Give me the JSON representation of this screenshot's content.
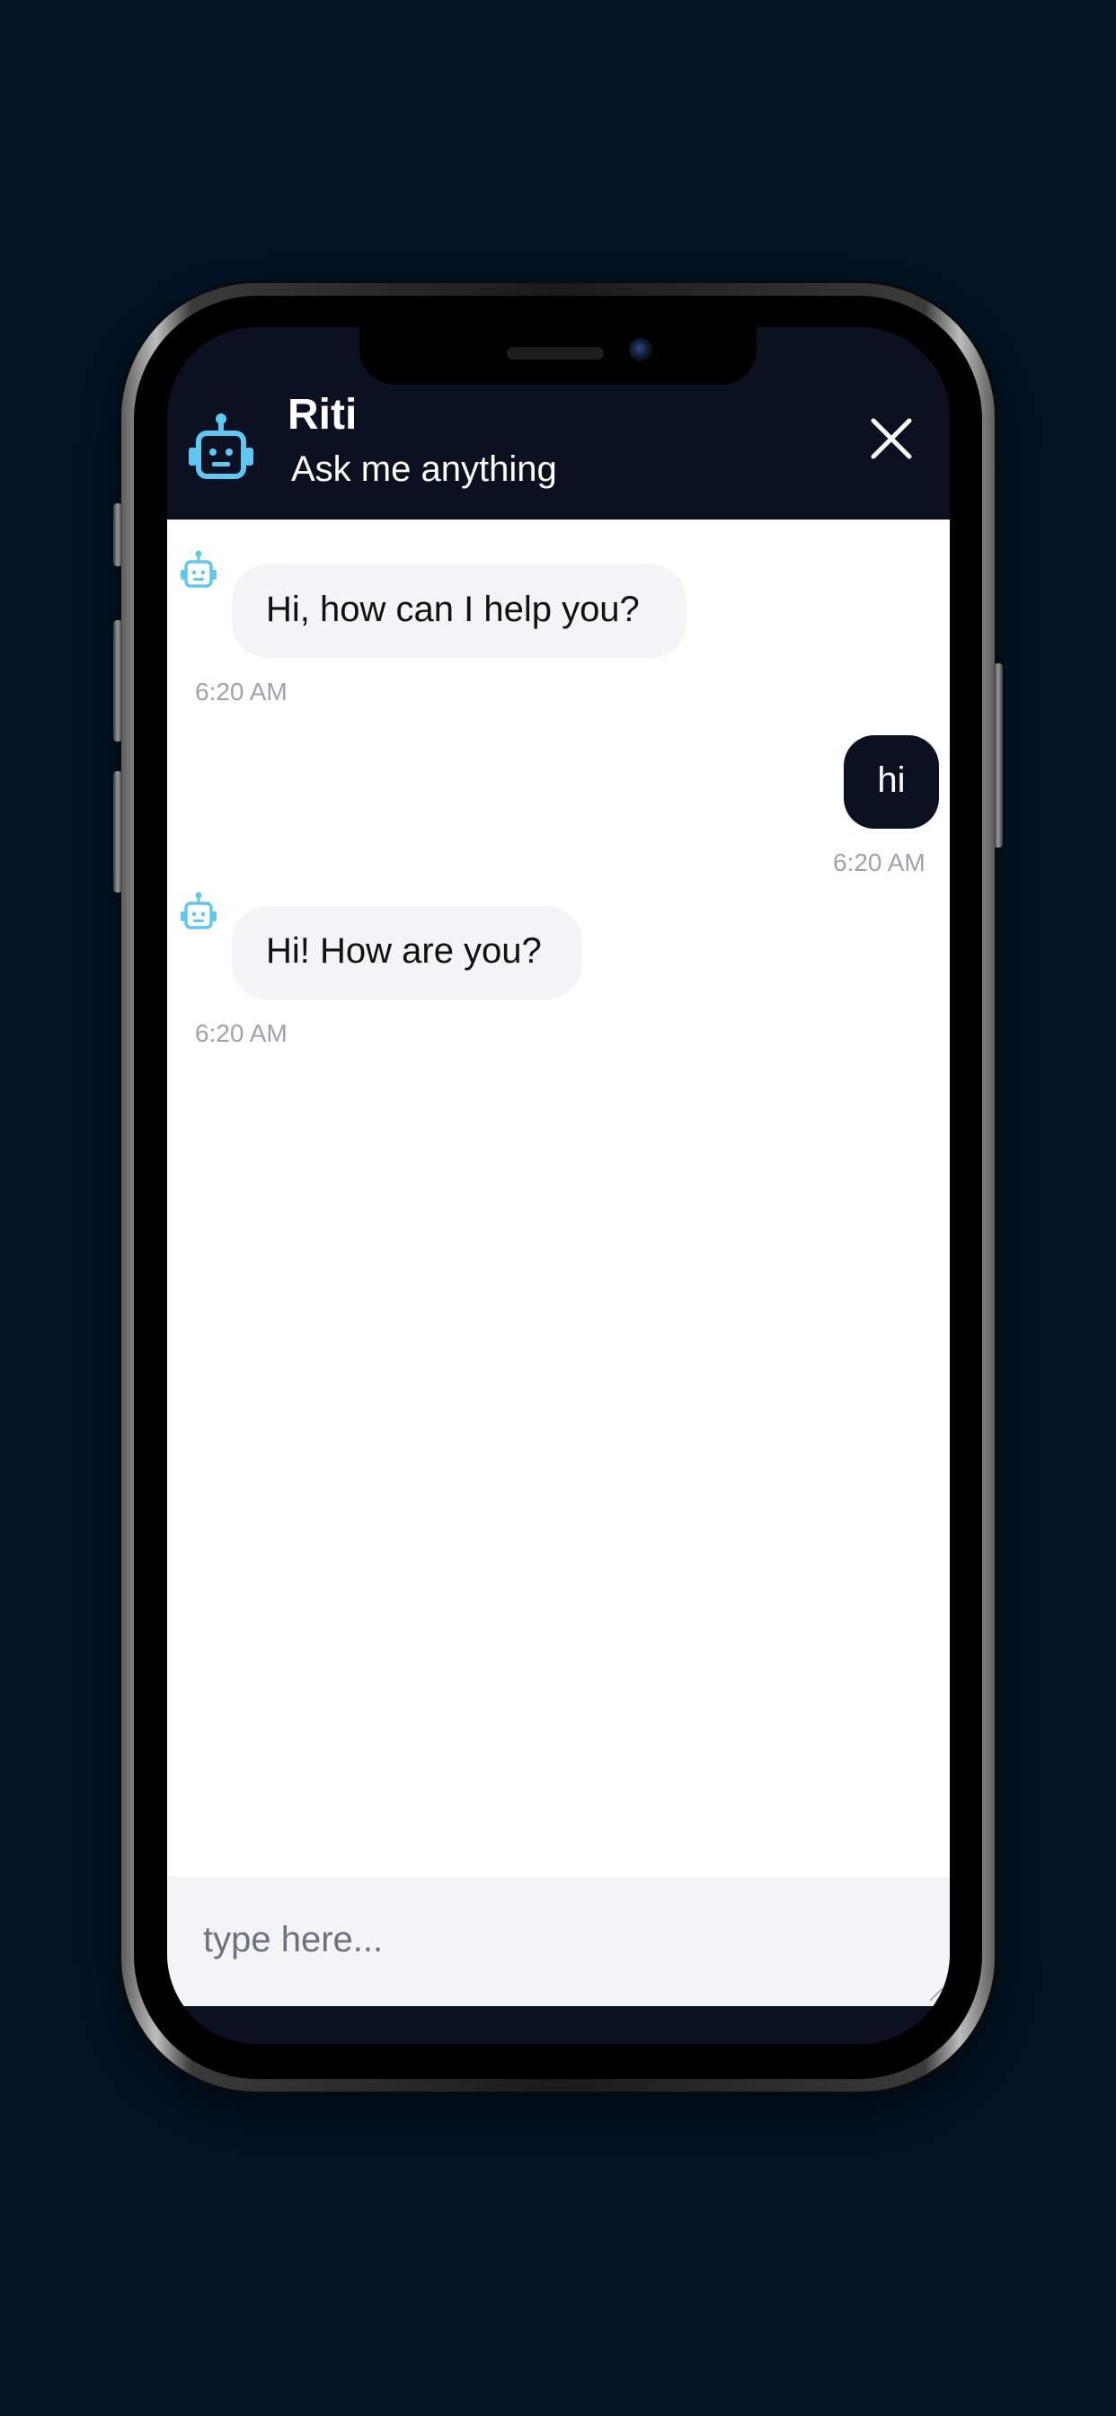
{
  "app": {
    "bot_name": "Riti",
    "bot_subtitle": "Ask me anything",
    "close_icon": "close-icon",
    "avatar_icon": "robot-icon",
    "colors": {
      "background": "#021425",
      "header": "#0b1120",
      "accent_icon": "#5ec8f2",
      "bot_bubble": "#f3f4f6",
      "user_bubble": "#0b1120",
      "timestamp": "#9ca3af"
    }
  },
  "messages": [
    {
      "sender": "bot",
      "text": "Hi, how can I help you?",
      "time": "6:20 AM"
    },
    {
      "sender": "user",
      "text": "hi",
      "time": "6:20 AM"
    },
    {
      "sender": "bot",
      "text": "Hi! How are you?",
      "time": "6:20 AM"
    }
  ],
  "composer": {
    "placeholder": "type here...",
    "value": ""
  }
}
